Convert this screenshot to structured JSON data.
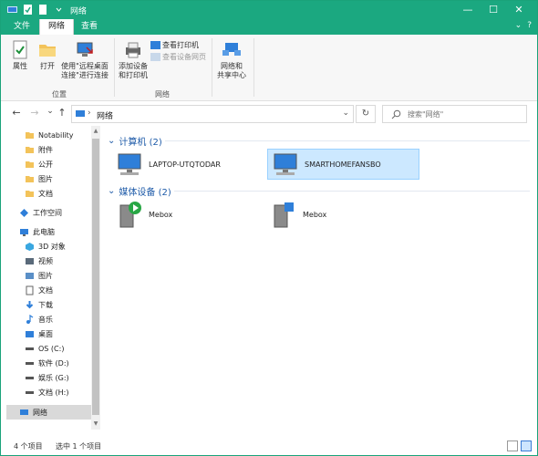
{
  "window": {
    "title": "网络",
    "controls": {
      "minimize": "—",
      "maximize": "☐",
      "close": "✕"
    }
  },
  "ribbon_tabs": [
    {
      "label": "文件",
      "active": false
    },
    {
      "label": "网络",
      "active": true
    },
    {
      "label": "查看",
      "active": false
    }
  ],
  "ribbon_right": {
    "chevron": "⌄",
    "help": "?"
  },
  "ribbon": {
    "properties": "属性",
    "open": "打开",
    "remote_desktop_line1": "使用\"远程桌面",
    "remote_desktop_line2": "连接\"进行连接",
    "group_location": "位置",
    "add_device_line1": "添加设备",
    "add_device_line2": "和打印机",
    "view_printers": "查看打印机",
    "view_device_page": "查看设备网页",
    "network_sharing_line1": "网络和",
    "network_sharing_line2": "共享中心",
    "group_network": "网络"
  },
  "nav": {
    "back": "←",
    "forward": "→",
    "recent": "⌄",
    "up": "↑",
    "address_sep": "›",
    "address": "网络",
    "address_dropdown": "⌄",
    "refresh": "↻",
    "search_placeholder": "搜索\"网络\""
  },
  "sidebar": {
    "items": [
      {
        "label": "Notability",
        "icon": "folder-icon"
      },
      {
        "label": "附件",
        "icon": "folder-icon"
      },
      {
        "label": "公开",
        "icon": "folder-icon"
      },
      {
        "label": "图片",
        "icon": "folder-icon"
      },
      {
        "label": "文档",
        "icon": "folder-icon"
      },
      {
        "label": "工作空间",
        "icon": "workspace-icon"
      },
      {
        "label": "此电脑",
        "icon": "pc-icon"
      },
      {
        "label": "3D 对象",
        "icon": "3d-objects-icon"
      },
      {
        "label": "视频",
        "icon": "video-icon"
      },
      {
        "label": "图片",
        "icon": "pictures-icon"
      },
      {
        "label": "文档",
        "icon": "documents-icon"
      },
      {
        "label": "下载",
        "icon": "download-icon"
      },
      {
        "label": "音乐",
        "icon": "music-icon"
      },
      {
        "label": "桌面",
        "icon": "desktop-icon"
      },
      {
        "label": "OS (C:)",
        "icon": "drive-icon"
      },
      {
        "label": "软件 (D:)",
        "icon": "drive-icon"
      },
      {
        "label": "娱乐 (G:)",
        "icon": "drive-icon"
      },
      {
        "label": "文档 (H:)",
        "icon": "drive-icon"
      },
      {
        "label": "网络",
        "icon": "network-icon"
      }
    ]
  },
  "content": {
    "group_computers": "计算机 (2)",
    "group_media": "媒体设备 (2)",
    "computers": [
      {
        "name": "LAPTOP-UTQTODAR",
        "selected": false
      },
      {
        "name": "SMARTHOMEFANSBO",
        "selected": true
      }
    ],
    "media": [
      {
        "name": "Mebox"
      },
      {
        "name": "Mebox"
      }
    ]
  },
  "status": {
    "count": "4 个项目",
    "selected": "选中 1 个项目"
  },
  "colors": {
    "accent": "#1ba880",
    "selection": "#cce8ff",
    "group_header": "#1d5aa8"
  }
}
